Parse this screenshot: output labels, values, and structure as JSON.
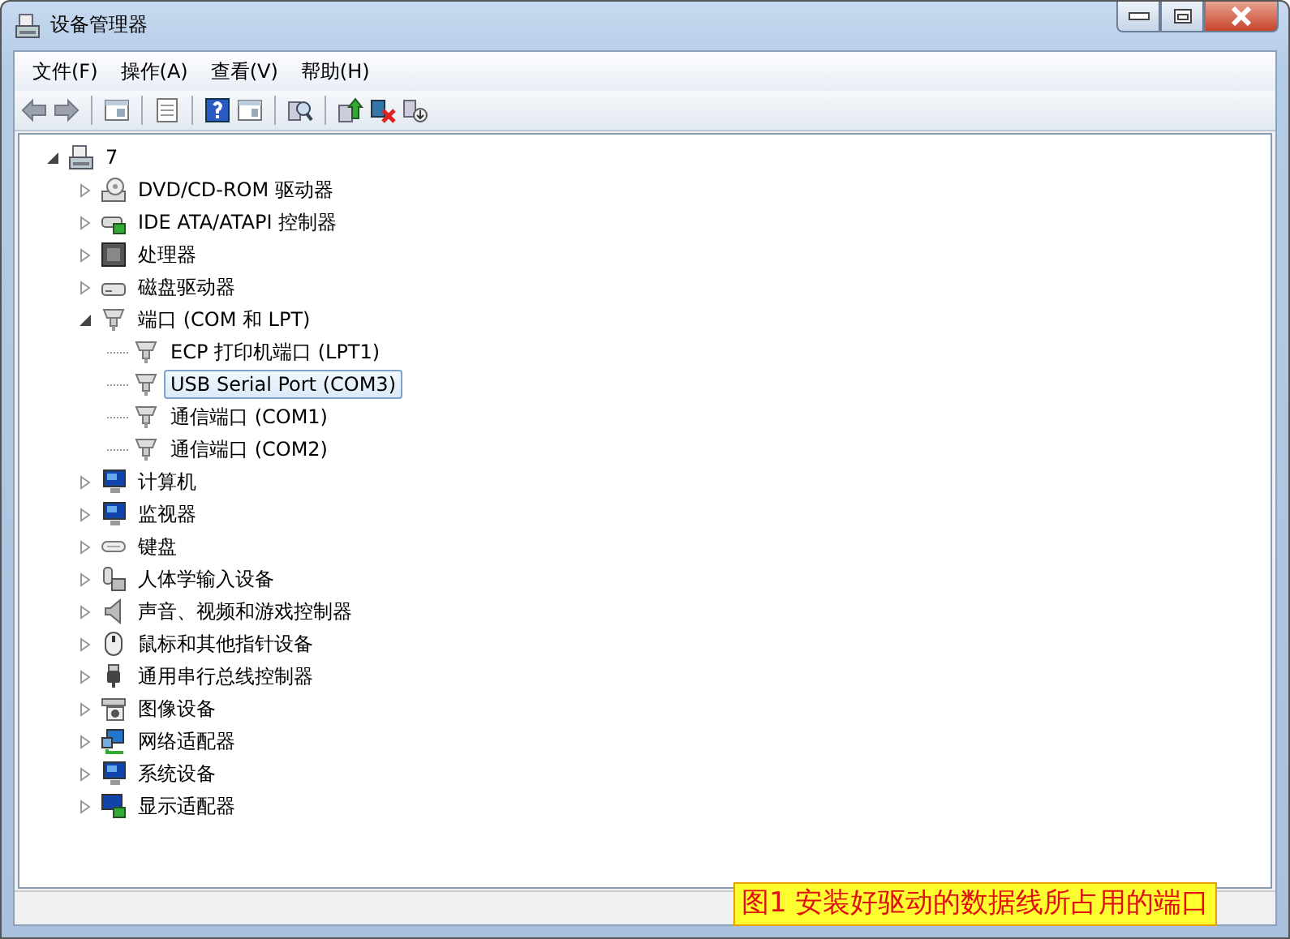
{
  "window": {
    "title": "设备管理器"
  },
  "menu": [
    {
      "label": "文件(F)"
    },
    {
      "label": "操作(A)"
    },
    {
      "label": "查看(V)"
    },
    {
      "label": "帮助(H)"
    }
  ],
  "tree": [
    {
      "label": "7",
      "kind": "computer",
      "expanded": true,
      "selected": false,
      "children": [
        {
          "label": "DVD/CD-ROM 驱动器",
          "kind": "disc",
          "expanded": false,
          "selected": false
        },
        {
          "label": "IDE ATA/ATAPI 控制器",
          "kind": "controller",
          "expanded": false,
          "selected": false
        },
        {
          "label": "处理器",
          "kind": "chip",
          "expanded": false,
          "selected": false
        },
        {
          "label": "磁盘驱动器",
          "kind": "drive",
          "expanded": false,
          "selected": false
        },
        {
          "label": "端口 (COM 和 LPT)",
          "kind": "port",
          "expanded": true,
          "selected": false,
          "children": [
            {
              "label": "ECP 打印机端口 (LPT1)",
              "kind": "port",
              "selected": false
            },
            {
              "label": "USB Serial Port (COM3)",
              "kind": "port",
              "selected": true
            },
            {
              "label": "通信端口 (COM1)",
              "kind": "port",
              "selected": false
            },
            {
              "label": "通信端口 (COM2)",
              "kind": "port",
              "selected": false
            }
          ]
        },
        {
          "label": "计算机",
          "kind": "monitor",
          "expanded": false,
          "selected": false
        },
        {
          "label": "监视器",
          "kind": "monitor",
          "expanded": false,
          "selected": false
        },
        {
          "label": "键盘",
          "kind": "keyboard",
          "expanded": false,
          "selected": false
        },
        {
          "label": "人体学输入设备",
          "kind": "hid",
          "expanded": false,
          "selected": false
        },
        {
          "label": "声音、视频和游戏控制器",
          "kind": "speaker",
          "expanded": false,
          "selected": false
        },
        {
          "label": "鼠标和其他指针设备",
          "kind": "mouse",
          "expanded": false,
          "selected": false
        },
        {
          "label": "通用串行总线控制器",
          "kind": "usb",
          "expanded": false,
          "selected": false
        },
        {
          "label": "图像设备",
          "kind": "camera",
          "expanded": false,
          "selected": false
        },
        {
          "label": "网络适配器",
          "kind": "network",
          "expanded": false,
          "selected": false
        },
        {
          "label": "系统设备",
          "kind": "monitor",
          "expanded": false,
          "selected": false
        },
        {
          "label": "显示适配器",
          "kind": "display",
          "expanded": false,
          "selected": false
        }
      ]
    }
  ],
  "caption": "图1 安装好驱动的数据线所占用的端口"
}
